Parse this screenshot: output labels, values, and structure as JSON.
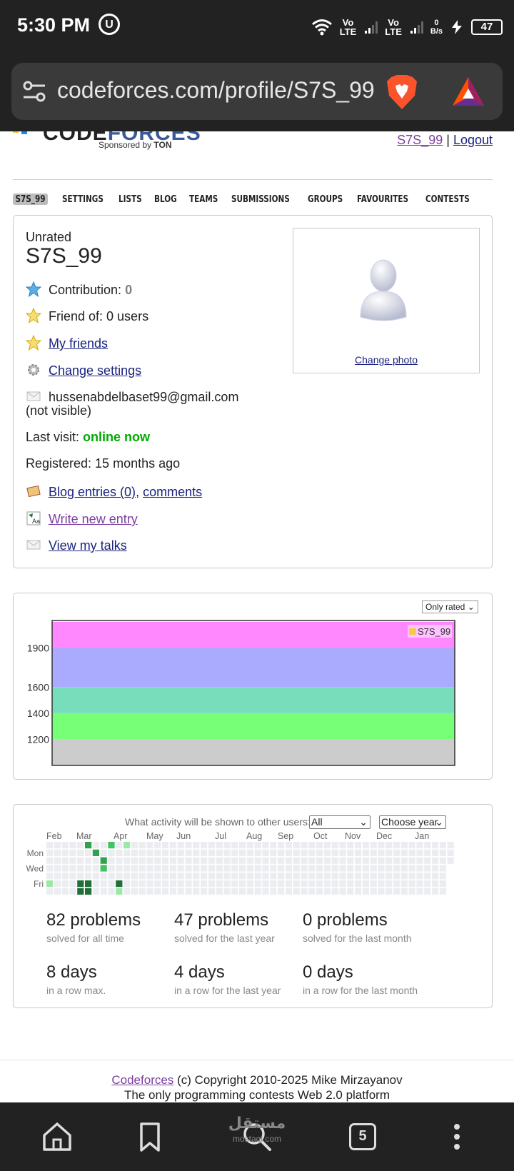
{
  "status_bar": {
    "time": "5:30 PM",
    "net1": "Vo\nLTE",
    "net2": "Vo\nLTE",
    "speed": "0\nB/s",
    "battery": "47"
  },
  "browser": {
    "url": "codeforces.com/profile/S7S_99"
  },
  "header": {
    "logo_text_a": "CODE",
    "logo_text_b": "FORCES",
    "sponsor_prefix": "Sponsored by ",
    "sponsor_name": "TON",
    "user_link": "S7S_99",
    "separator": "|",
    "logout": "Logout"
  },
  "menu": [
    "S7S_99",
    "SETTINGS",
    "LISTS",
    "BLOG",
    "TEAMS",
    "SUBMISSIONS",
    "GROUPS",
    "FAVOURITES",
    "CONTESTS"
  ],
  "profile": {
    "rank": "Unrated",
    "handle": "S7S_99",
    "contribution_label": "Contribution: ",
    "contribution_value": "0",
    "friend_of": "Friend of: 0 users",
    "my_friends": "My friends",
    "change_settings": "Change settings",
    "email": "hussenabdelbaset99@gmail.com",
    "email_note": "(not visible)",
    "last_visit_label": "Last visit: ",
    "last_visit_value": "online now",
    "registered": "Registered: 15 months ago",
    "blog_entries": "Blog entries (0)",
    "comma": ", ",
    "comments": "comments",
    "write_new_entry": "Write new entry",
    "view_talks": "View my talks",
    "change_photo": "Change photo"
  },
  "rating": {
    "filter": "Only rated",
    "legend": "S7S_99",
    "y_ticks": [
      "1900",
      "1600",
      "1400",
      "1200"
    ],
    "bands": [
      {
        "from": 1900,
        "to": 2100,
        "color": "#ff88ff"
      },
      {
        "from": 1600,
        "to": 1900,
        "color": "#aaaaff"
      },
      {
        "from": 1400,
        "to": 1600,
        "color": "#77ddbb"
      },
      {
        "from": 1200,
        "to": 1400,
        "color": "#77ff77"
      },
      {
        "from": 1000,
        "to": 1200,
        "color": "#cccccc"
      }
    ]
  },
  "activity": {
    "label": "What activity will be shown to other users:",
    "visibility": "All",
    "year": "Choose year",
    "months": [
      "Feb",
      "Mar",
      "Apr",
      "May",
      "Jun",
      "Jul",
      "Aug",
      "Sep",
      "Oct",
      "Nov",
      "Dec",
      "Jan"
    ],
    "days": [
      "Mon",
      "Wed",
      "Fri"
    ],
    "colors": {
      "empty": "#ebedf0",
      "l1": "#9be9a8",
      "l2": "#40c463",
      "l3": "#30a14e",
      "l4": "#216e39"
    },
    "stats": [
      {
        "num": "82 problems",
        "sub": "solved for all time"
      },
      {
        "num": "47 problems",
        "sub": "solved for the last year"
      },
      {
        "num": "0 problems",
        "sub": "solved for the last month"
      },
      {
        "num": "8 days",
        "sub": "in a row max."
      },
      {
        "num": "4 days",
        "sub": "in a row for the last year"
      },
      {
        "num": "0 days",
        "sub": "in a row for the last month"
      }
    ]
  },
  "footer": {
    "link": "Codeforces",
    "copyright": " (c) Copyright 2010-2025 Mike Mirzayanov",
    "tagline": "The only programming contests Web 2.0 platform"
  },
  "nav": {
    "tabs": "5",
    "watermark": "مستقل",
    "watermark_sub": "mostaql.com"
  }
}
